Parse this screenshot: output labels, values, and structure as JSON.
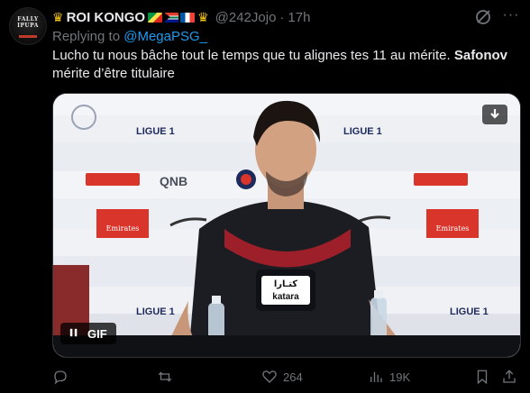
{
  "author": {
    "display_name": "ROI KONGO",
    "handle": "@242Jojo",
    "separator": "·",
    "time": "17h",
    "avatar_text": "FALLY IPUPA"
  },
  "reply": {
    "prefix": "Replying to",
    "to": "@MegaPSG_"
  },
  "tweet": {
    "text_plain": "Lucho tu nous bâche tout le temps que tu alignes tes 11 au mérite. ",
    "text_bold": "Safonov",
    "text_end": " mérite d’être titulaire"
  },
  "media": {
    "gif_label": "GIF",
    "sponsors": [
      "LIGUE 1",
      "QNB",
      "Emirates",
      "katara"
    ]
  },
  "actions": {
    "reply_count": "",
    "retweet_count": "",
    "like_count": "264",
    "view_count": "19K"
  },
  "colors": {
    "accent": "#1d9bf0",
    "muted": "#71767b",
    "background": "#000000",
    "text": "#e7e9ea"
  },
  "icons": [
    "crown-icon",
    "grok-icon",
    "more-icon",
    "download-icon",
    "pause-icon",
    "reply-icon",
    "retweet-icon",
    "like-icon",
    "views-icon",
    "bookmark-icon",
    "share-icon"
  ]
}
